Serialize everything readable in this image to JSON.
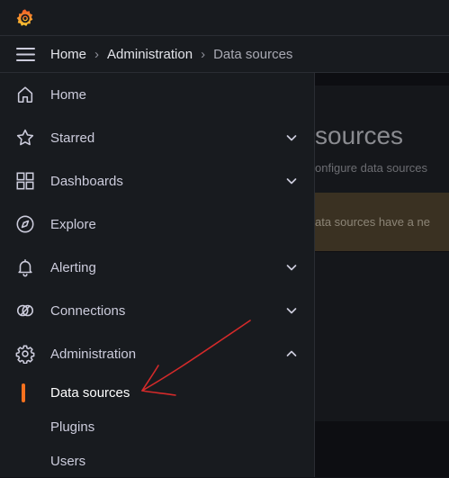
{
  "breadcrumb": {
    "items": [
      "Home",
      "Administration",
      "Data sources"
    ],
    "separator": "›"
  },
  "background_page": {
    "title": "sources",
    "subtitle": "onfigure data sources",
    "alert": "ata sources have a ne"
  },
  "menu": {
    "items": [
      {
        "label": "Home",
        "icon": "home-icon",
        "expandable": false
      },
      {
        "label": "Starred",
        "icon": "star-icon",
        "expandable": true
      },
      {
        "label": "Dashboards",
        "icon": "apps-icon",
        "expandable": true
      },
      {
        "label": "Explore",
        "icon": "compass-icon",
        "expandable": false
      },
      {
        "label": "Alerting",
        "icon": "bell-icon",
        "expandable": true
      },
      {
        "label": "Connections",
        "icon": "link-icon",
        "expandable": true
      },
      {
        "label": "Administration",
        "icon": "cog-icon",
        "expandable": true,
        "expanded": true
      }
    ],
    "subitems": [
      {
        "label": "Data sources",
        "active": true
      },
      {
        "label": "Plugins",
        "active": false
      },
      {
        "label": "Users",
        "active": false
      }
    ]
  },
  "colors": {
    "accent": "#f7711e",
    "annotation": "#d42a2a",
    "background": "#181b1f"
  }
}
